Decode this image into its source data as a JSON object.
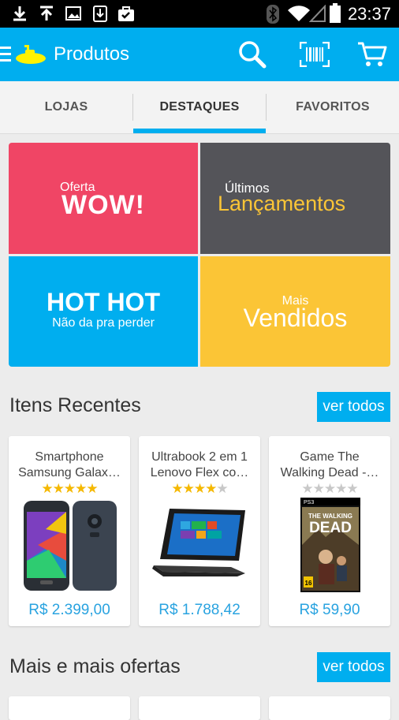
{
  "status_bar": {
    "time": "23:37"
  },
  "app_bar": {
    "title": "Produtos"
  },
  "tabs": [
    {
      "label": "LOJAS",
      "selected": false
    },
    {
      "label": "DESTAQUES",
      "selected": true
    },
    {
      "label": "FAVORITOS",
      "selected": false
    }
  ],
  "tiles": {
    "oferta": {
      "small": "Oferta",
      "big": "WOW!"
    },
    "lancamentos": {
      "small": "Últimos",
      "big": "Lançamentos"
    },
    "hot": {
      "big": "HOT HOT",
      "small": "Não da pra perder"
    },
    "vendidos": {
      "small": "Mais",
      "big": "Vendidos"
    }
  },
  "recent": {
    "title": "Itens Recentes",
    "view_all": "ver todos",
    "items": [
      {
        "name": "Smartphone\nSamsung Galax…",
        "rating": 5,
        "price": "R$ 2.399,00"
      },
      {
        "name": "Ultrabook 2 em 1\nLenovo Flex co…",
        "rating": 4,
        "price": "R$ 1.788,42"
      },
      {
        "name": "Game The\nWalking Dead -…",
        "rating": 0,
        "price": "R$ 59,90"
      }
    ]
  },
  "more_offers": {
    "title": "Mais e mais ofertas",
    "view_all": "ver todos"
  },
  "game_cover": {
    "platform": "PS3",
    "title_line1": "THE WALKING",
    "title_line2": "DEAD",
    "age_rating": "16"
  },
  "colors": {
    "accent": "#00aeef",
    "wow": "#f04565",
    "lancamentos": "#545459",
    "hot": "#00aeef",
    "vendidos": "#fbc536",
    "price": "#29a3e0",
    "star_filled": "#f5b800",
    "star_empty": "#c8c8c8"
  }
}
